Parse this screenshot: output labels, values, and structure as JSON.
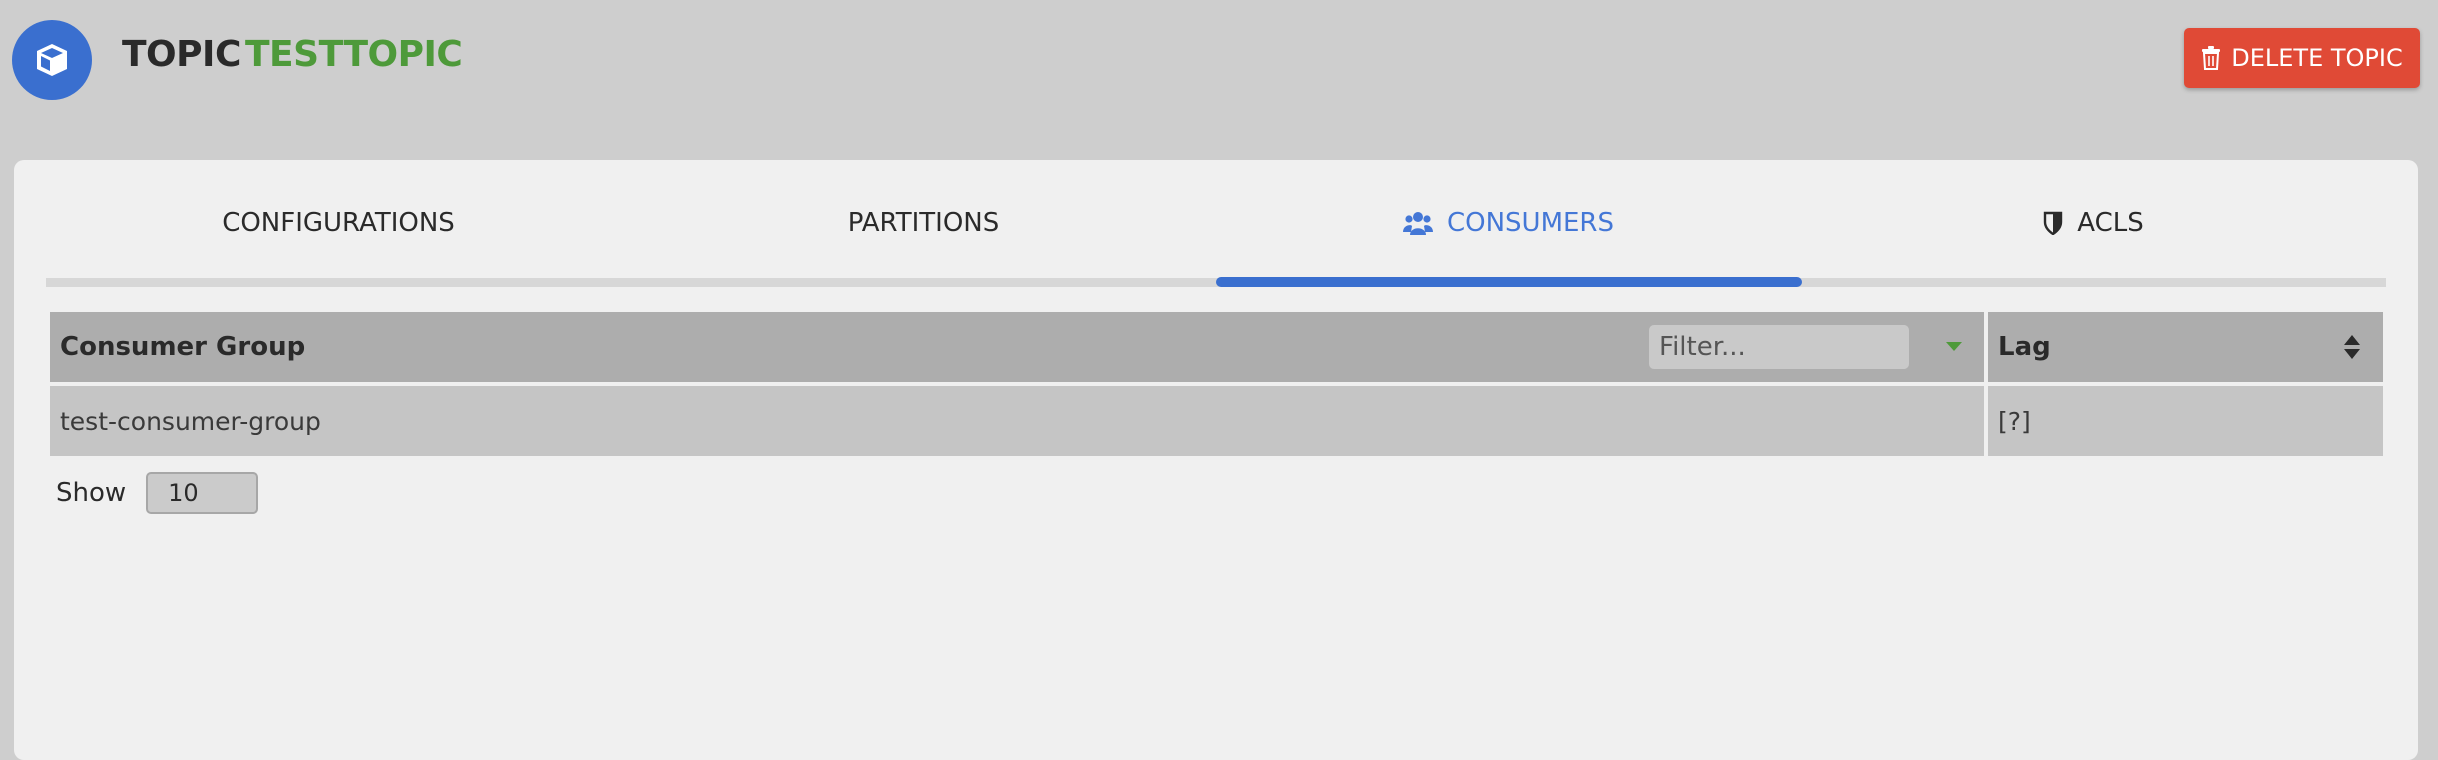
{
  "header": {
    "title_prefix": "TOPIC",
    "topic_name": "TESTTOPIC",
    "delete_label": "DELETE TOPIC",
    "avatar_icon": "cube-icon"
  },
  "tabs": [
    {
      "label": "CONFIGURATIONS",
      "active": false
    },
    {
      "label": "PARTITIONS",
      "active": false
    },
    {
      "label": "CONSUMERS",
      "active": true,
      "icon": "users-icon"
    },
    {
      "label": "ACLS",
      "active": false,
      "icon": "shield-icon"
    }
  ],
  "table": {
    "columns": [
      "Consumer Group",
      "Lag"
    ],
    "filter_placeholder": "Filter...",
    "rows": [
      [
        "test-consumer-group",
        "[?]"
      ]
    ]
  },
  "pagination": {
    "show_label": "Show",
    "page_size": "10"
  },
  "colors": {
    "accent": "#3a6fcf",
    "topic_name": "#4e9a3a",
    "danger": "#e04a36",
    "active_tab": "#4477d6"
  }
}
